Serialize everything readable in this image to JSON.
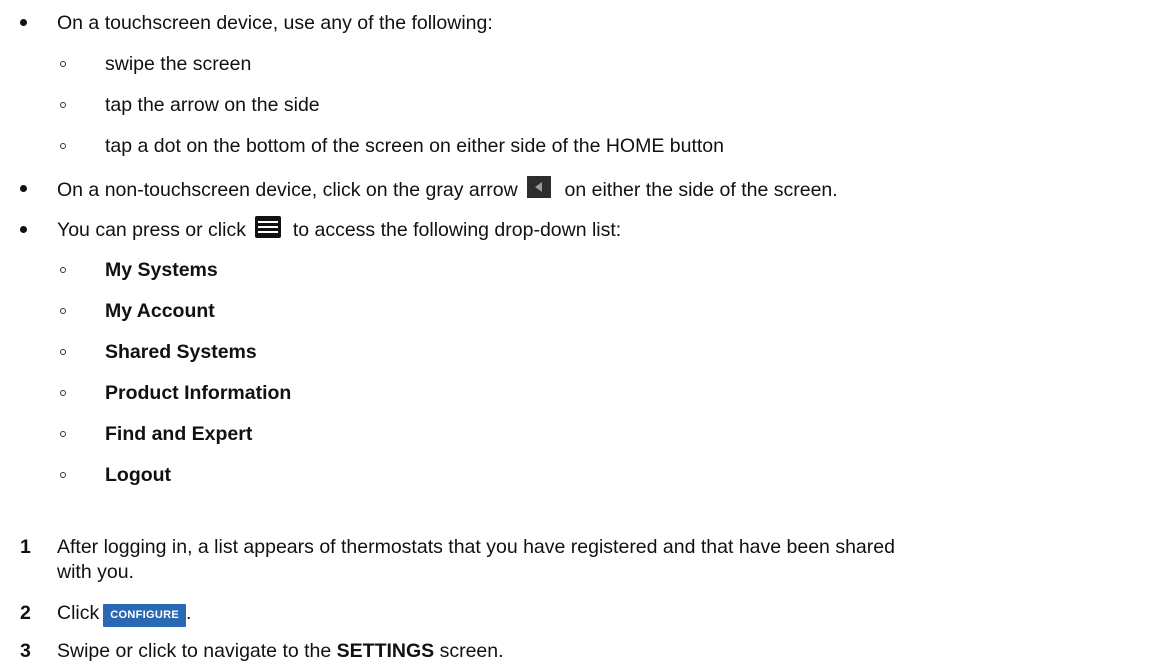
{
  "touch": {
    "intro": "On a touchscreen device, use any of the following:",
    "items": [
      "swipe the screen",
      "tap the arrow on the side",
      "tap a dot on the bottom of the screen on either side of the HOME button"
    ]
  },
  "nontouch": {
    "before": "On a non-touchscreen device, click on the gray arrow",
    "after": "on either the side of the screen."
  },
  "menu": {
    "before": "You can press or click",
    "after": "to access the following drop-down list:",
    "items": [
      "My Systems",
      "My Account",
      "Shared Systems",
      "Product Information",
      "Find and Expert",
      "Logout"
    ]
  },
  "steps": [
    {
      "number": "1",
      "line1": "After logging in, a list appears of thermostats that you have registered and that have been shared",
      "line2": "with you."
    },
    {
      "number": "2",
      "before": "Click",
      "button": "CONFIGURE",
      "after": "."
    },
    {
      "number": "3",
      "before": "Swipe or click to navigate to the",
      "bold": "SETTINGS",
      "after": "screen."
    }
  ],
  "icons": {
    "arrow": "left-arrow-icon",
    "menu": "hamburger-menu-icon"
  },
  "colors": {
    "configure_button": "#2a68b3",
    "arrow_button": "#2d2d2d"
  }
}
